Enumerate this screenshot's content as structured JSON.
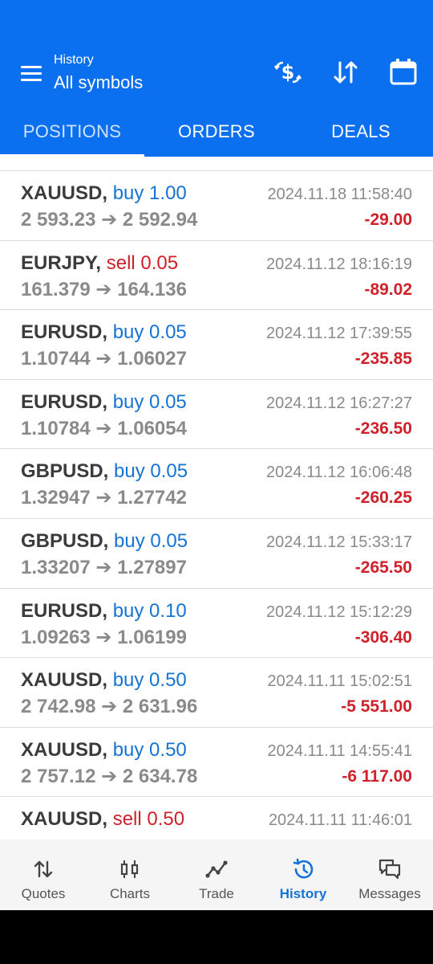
{
  "header": {
    "subtitle": "History",
    "title": "All symbols",
    "icons": [
      "menu-icon",
      "dollar-exchange-icon",
      "sort-icon",
      "calendar-icon"
    ]
  },
  "tabs": [
    {
      "label": "POSITIONS",
      "active": true
    },
    {
      "label": "ORDERS",
      "active": false
    },
    {
      "label": "DEALS",
      "active": false
    }
  ],
  "positions": [
    {
      "symbol": "XAUUSD,",
      "side": "buy",
      "volume": "buy 1.00",
      "prices": "2 593.23 ➔ 2 592.94",
      "time": "2024.11.18 11:58:40",
      "profit": "-29.00"
    },
    {
      "symbol": "EURJPY,",
      "side": "sell",
      "volume": "sell 0.05",
      "prices": "161.379 ➔ 164.136",
      "time": "2024.11.12 18:16:19",
      "profit": "-89.02"
    },
    {
      "symbol": "EURUSD,",
      "side": "buy",
      "volume": "buy 0.05",
      "prices": "1.10744 ➔ 1.06027",
      "time": "2024.11.12 17:39:55",
      "profit": "-235.85"
    },
    {
      "symbol": "EURUSD,",
      "side": "buy",
      "volume": "buy 0.05",
      "prices": "1.10784 ➔ 1.06054",
      "time": "2024.11.12 16:27:27",
      "profit": "-236.50"
    },
    {
      "symbol": "GBPUSD,",
      "side": "buy",
      "volume": "buy 0.05",
      "prices": "1.32947 ➔ 1.27742",
      "time": "2024.11.12 16:06:48",
      "profit": "-260.25"
    },
    {
      "symbol": "GBPUSD,",
      "side": "buy",
      "volume": "buy 0.05",
      "prices": "1.33207 ➔ 1.27897",
      "time": "2024.11.12 15:33:17",
      "profit": "-265.50"
    },
    {
      "symbol": "EURUSD,",
      "side": "buy",
      "volume": "buy 0.10",
      "prices": "1.09263 ➔ 1.06199",
      "time": "2024.11.12 15:12:29",
      "profit": "-306.40"
    },
    {
      "symbol": "XAUUSD,",
      "side": "buy",
      "volume": "buy 0.50",
      "prices": "2 742.98 ➔ 2 631.96",
      "time": "2024.11.11 15:02:51",
      "profit": "-5 551.00"
    },
    {
      "symbol": "XAUUSD,",
      "side": "buy",
      "volume": "buy 0.50",
      "prices": "2 757.12 ➔ 2 634.78",
      "time": "2024.11.11 14:55:41",
      "profit": "-6 117.00"
    },
    {
      "symbol": "XAUUSD,",
      "side": "sell",
      "volume": "sell 0.50",
      "prices": "",
      "time": "2024.11.11 11:46:01",
      "profit": ""
    }
  ],
  "bottom_nav": [
    {
      "label": "Quotes",
      "icon": "quotes-icon",
      "active": false
    },
    {
      "label": "Charts",
      "icon": "charts-icon",
      "active": false
    },
    {
      "label": "Trade",
      "icon": "trade-icon",
      "active": false
    },
    {
      "label": "History",
      "icon": "history-icon",
      "active": true
    },
    {
      "label": "Messages",
      "icon": "messages-icon",
      "active": false
    }
  ],
  "colors": {
    "header_bg": "#0b70f0",
    "buy": "#1573d6",
    "sell": "#d0202a",
    "loss": "#d0202a",
    "muted": "#8a8a8a",
    "nav_active": "#1573d6"
  }
}
